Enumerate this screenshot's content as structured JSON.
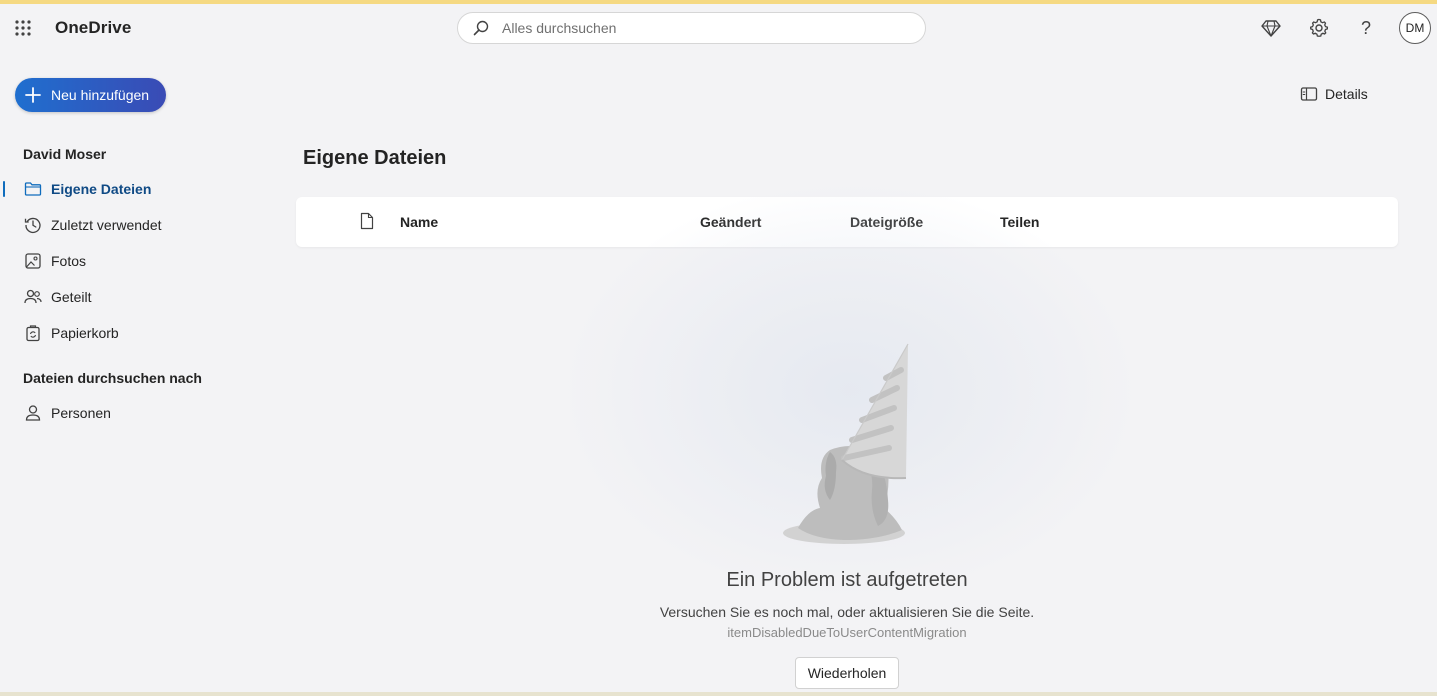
{
  "app": {
    "name": "OneDrive"
  },
  "search": {
    "placeholder": "Alles durchsuchen"
  },
  "header": {
    "icons": [
      "waffle-icon",
      "search-icon",
      "diamond-icon",
      "gear-icon",
      "help-icon"
    ],
    "help_glyph": "?",
    "avatar_initials": "DM"
  },
  "sidebar": {
    "new_button_label": "Neu hinzufügen",
    "user_name": "David Moser",
    "items": [
      {
        "label": "Eigene Dateien",
        "icon": "folder-icon",
        "active": true
      },
      {
        "label": "Zuletzt verwendet",
        "icon": "history-icon",
        "active": false
      },
      {
        "label": "Fotos",
        "icon": "image-icon",
        "active": false
      },
      {
        "label": "Geteilt",
        "icon": "people-icon",
        "active": false
      },
      {
        "label": "Papierkorb",
        "icon": "recycle-bin-icon",
        "active": false
      }
    ],
    "browse_title": "Dateien durchsuchen nach",
    "browse_items": [
      {
        "label": "Personen",
        "icon": "person-icon"
      }
    ]
  },
  "toolbar": {
    "details_label": "Details"
  },
  "main": {
    "title": "Eigene Dateien",
    "columns": {
      "name": "Name",
      "modified": "Geändert",
      "size": "Dateigröße",
      "sharing": "Teilen"
    }
  },
  "error": {
    "title": "Ein Problem ist aufgetreten",
    "message": "Versuchen Sie es noch mal, oder aktualisieren Sie die Seite.",
    "code": "itemDisabledDueToUserContentMigration",
    "retry_label": "Wiederholen"
  },
  "colors": {
    "accent": "#0f6cbd",
    "active_text": "#0f4a85",
    "top_stripe": "#f5d982",
    "background": "#f3f3f5"
  }
}
